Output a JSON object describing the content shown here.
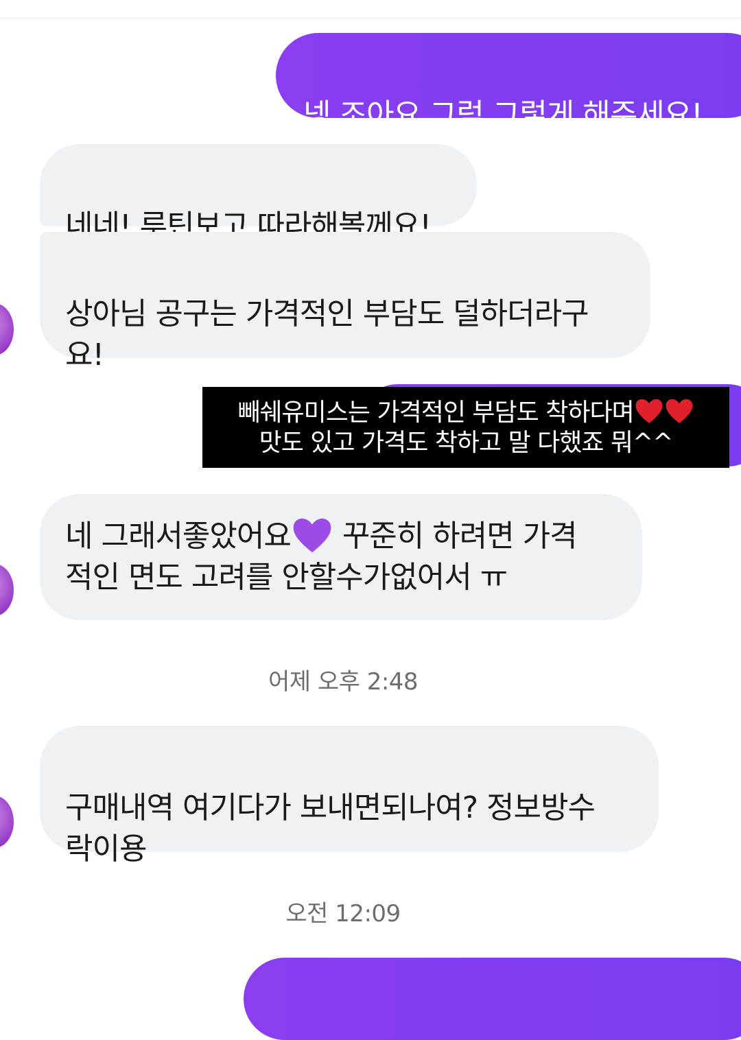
{
  "messages": {
    "m1": "넹 조아요 그럼 그렇게 해주세요!",
    "m2": "네네! 루틴보고 따라해볼께요!",
    "m3": "상아님 공구는 가격적인 부담도 덜하더라구\n요!",
    "caption_line1": "빼쉐유미스는 가격적인 부담도 착하다며",
    "caption_line2": "맛도 있고 가격도 착하고 말 다했죠 뭐^^",
    "m5_before": "네 그래서좋았어요",
    "m5_after": " 꾸준히 하려면 가격\n적인 면도 고려를 안할수가없어서 ㅠ",
    "m6": "구매내역 여기다가 보내면되나여? 정보방수\n락이용"
  },
  "timestamps": {
    "t1": "어제 오후 2:48",
    "t2": "오전 12:09"
  },
  "colors": {
    "outgoing_bubble": "#8a3ef0",
    "incoming_bubble": "#eff2f4",
    "caption_bg": "#000000",
    "heart_red": "#e0202a",
    "heart_purple": "#9b4be6"
  },
  "icons": {
    "caption_emoji": "red-heart-icon",
    "message_emoji": "purple-heart-icon"
  }
}
